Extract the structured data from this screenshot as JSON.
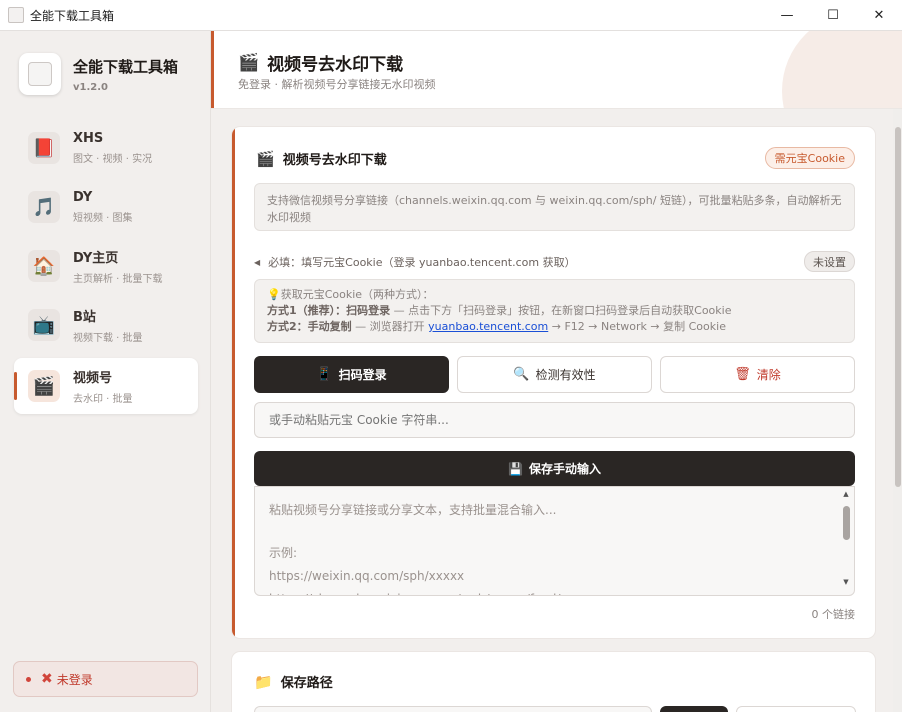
{
  "window": {
    "title": "全能下载工具箱",
    "minimize_icon": "—",
    "maximize_icon": "☐",
    "close_icon": "✕"
  },
  "brand": {
    "name": "全能下载工具箱",
    "version": "v1.2.0"
  },
  "sidebar": {
    "items": [
      {
        "label": "XHS",
        "sub": "图文 · 视频 · 实况",
        "icon": "📕"
      },
      {
        "label": "DY",
        "sub": "短视频 · 图集",
        "icon": "🎵"
      },
      {
        "label": "DY主页",
        "sub": "主页解析 · 批量下载",
        "icon": "🏠"
      },
      {
        "label": "B站",
        "sub": "视频下载 · 批量",
        "icon": "📺"
      },
      {
        "label": "视频号",
        "sub": "去水印 · 批量",
        "icon": "🎬"
      }
    ],
    "active_index": 4,
    "login_status": "未登录",
    "login_icon": "✖"
  },
  "header": {
    "title": "视频号去水印下载",
    "icon": "🎬",
    "subtitle": "免登录 · 解析视频号分享链接无水印视频"
  },
  "card": {
    "title": "视频号去水印下载",
    "icon": "🎬",
    "badge": "需元宝Cookie",
    "description": "支持微信视频号分享链接（channels.weixin.qq.com 与 weixin.qq.com/sph/ 短链），可批量粘贴多条，自动解析无水印视频",
    "cookie_toggle": "◀",
    "cookie_label": "必填：填写元宝Cookie（登录 yuanbao.tencent.com 获取）",
    "unset_label": "未设置",
    "info": {
      "icon": "💡",
      "heading": "获取元宝Cookie（两种方式）：",
      "method1_title": "方式1（推荐）：扫码登录",
      "method1_text": " — 点击下方「扫码登录」按钮，在新窗口扫码登录后自动获取Cookie",
      "method2_title": "方式2：手动复制",
      "method2_text_a": " — 浏览器打开 ",
      "method2_link": "yuanbao.tencent.com",
      "method2_text_b": " → F12 → Network → 复制 Cookie"
    },
    "buttons": {
      "scan": {
        "label": "扫码登录",
        "icon": "📱"
      },
      "check": {
        "label": "检测有效性",
        "icon": "🔍"
      },
      "clear": {
        "label": "清除",
        "icon": "🗑"
      }
    },
    "cookie_input_placeholder": "或手动粘贴元宝 Cookie 字符串...",
    "save_button": {
      "label": "保存手动输入",
      "icon": "💾"
    },
    "links_placeholder": {
      "line1": "粘贴视频号分享链接或分享文本，支持批量混合输入...",
      "line2": "示例:",
      "line3": "https://weixin.qq.com/sph/xxxxx",
      "line4": "https://channels.weixin.qq.com/web/pages/feed/xxxxx"
    },
    "link_count": "0 个链接"
  },
  "card2": {
    "title": "保存路径",
    "icon": "📁"
  },
  "colors": {
    "accent": "#c75a2e",
    "dark_button": "#2a2624",
    "danger": "#c0392b",
    "link": "#1a4fd6"
  }
}
